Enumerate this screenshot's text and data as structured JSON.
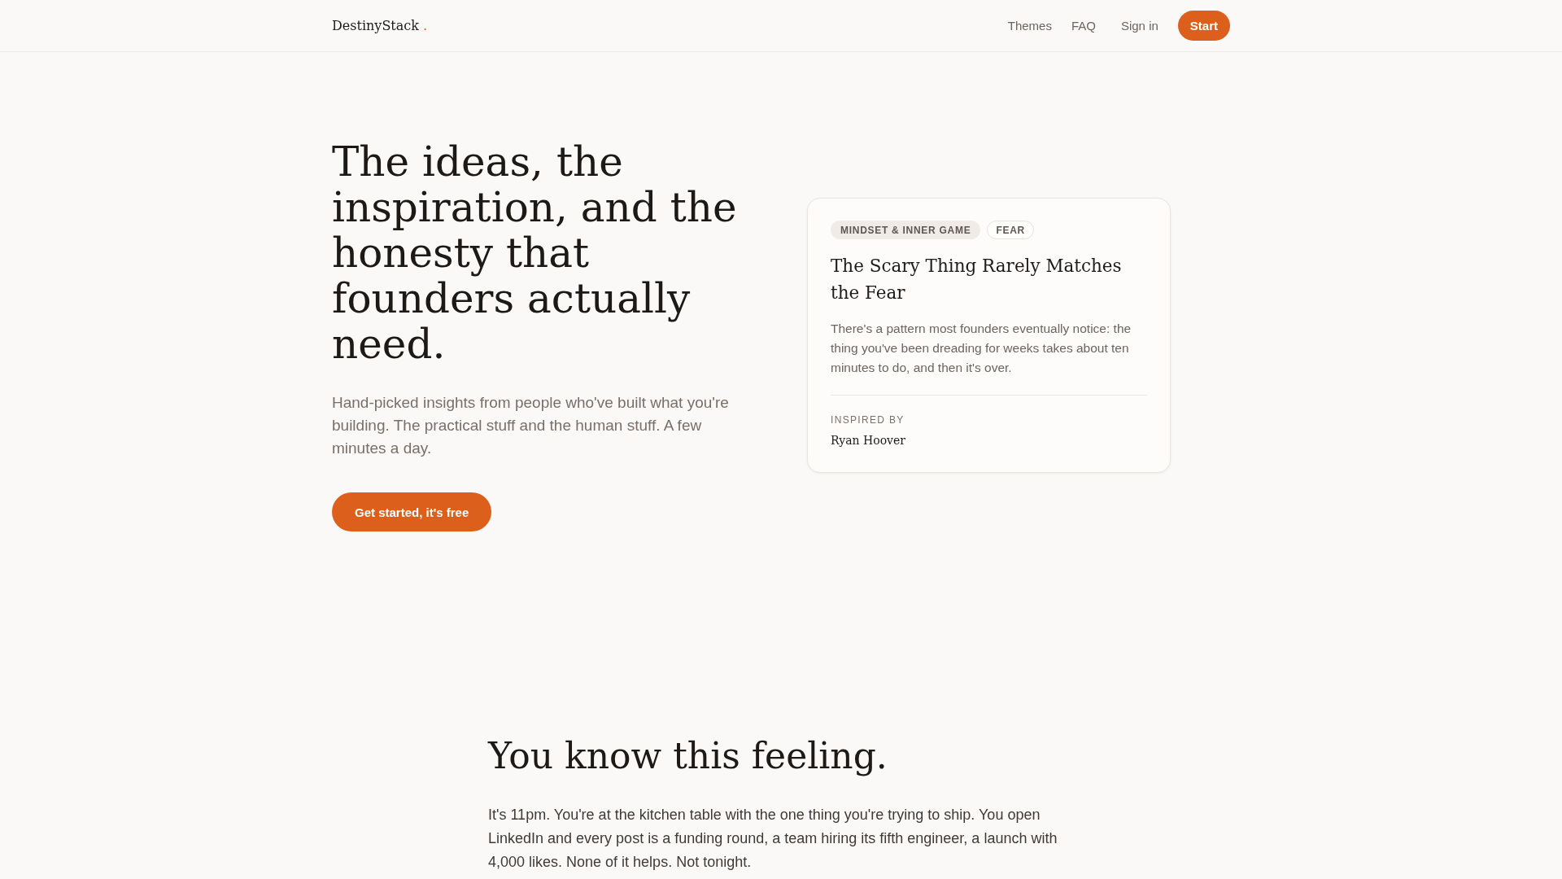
{
  "header": {
    "logo": "DestinyStack",
    "logo_mark": ".",
    "nav": [
      "Themes",
      "FAQ"
    ],
    "sign_in": "Sign in",
    "cta": "Start"
  },
  "hero": {
    "title": "The ideas, the inspiration, and the honesty that founders actually need.",
    "subtitle": "Hand-picked insights from people who've built what you're building. The practical stuff and the human stuff. A few minutes a day.",
    "button": "Get started, it's free"
  },
  "card": {
    "tags": [
      {
        "label": "MINDSET & INNER GAME",
        "kind": "category"
      },
      {
        "label": "FEAR",
        "kind": "topic"
      }
    ],
    "title": "The Scary Thing Rarely Matches the Fear",
    "excerpt": "There's a pattern most founders eventually notice: the thing you've been dreading for weeks takes about ten minutes to do, and then it's over.",
    "credit_label": "INSPIRED BY",
    "credit_name": "Ryan Hoover"
  },
  "section": {
    "title": "You know this feeling.",
    "body": "It's 11pm. You're at the kitchen table with the one thing you're trying to ship. You open LinkedIn and every post is a funding round, a team hiring its fifth engineer, a launch with 4,000 likes. None of it helps. Not tonight."
  }
}
